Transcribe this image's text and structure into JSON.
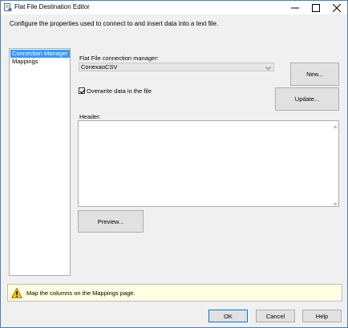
{
  "window": {
    "title": "Flat File Destination Editor",
    "description": "Configure the properties used to connect to and insert data into a text file."
  },
  "nav": {
    "items": [
      {
        "label": "Connection Manager",
        "selected": true
      },
      {
        "label": "Mappings",
        "selected": false
      }
    ]
  },
  "connection": {
    "label": "Flat File connection manager:",
    "value": "ConexaoCSV",
    "new_button": "New...",
    "update_button": "Update..."
  },
  "overwrite": {
    "label": "Overwrite data in the file",
    "checked": true
  },
  "header": {
    "label": "Header:",
    "text": ""
  },
  "preview_button": "Preview...",
  "message": {
    "text": "Map the columns on the Mappings page.",
    "icon": "warning-icon"
  },
  "buttons": {
    "ok": "OK",
    "cancel": "Cancel",
    "help": "Help"
  },
  "colors": {
    "selection": "#3399ff",
    "message_bg": "#ffffe1",
    "ok_border": "#0078d7"
  }
}
